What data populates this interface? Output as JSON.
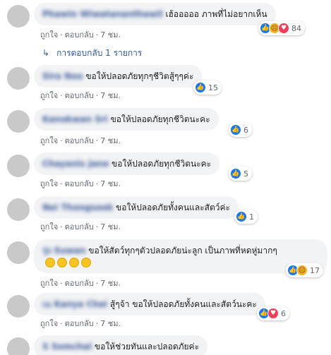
{
  "comments": [
    {
      "name": "Phawin Wiwatananthawil",
      "text": "เฮ้อออออ ภาพที่ไม่อยากเห็น",
      "like": "ถูกใจ",
      "reply": "ตอบกลับ",
      "time": "7 ชม.",
      "reactions": [
        "like",
        "sad",
        "love"
      ],
      "count": "84"
    },
    {
      "name": "Sira Noo",
      "text": "ขอให้ปลอดภัยทุกๆชีวิตสู้ๆๆค่ะ",
      "like": "ถูกใจ",
      "reply": "ตอบกลับ",
      "time": "7 ชม.",
      "reactions": [
        "like"
      ],
      "count": "15"
    },
    {
      "name": "Kanokwan Sri",
      "text": "ขอให้ปลอดภัยทุกชีวิตนะคะ",
      "like": "ถูกใจ",
      "reply": "ตอบกลับ",
      "time": "7 ชม.",
      "reactions": [
        "like"
      ],
      "count": "6"
    },
    {
      "name": "Chayanis Jane",
      "text": "ขอให้ปลอดภัยทุกชีวิตนะคะ",
      "like": "ถูกใจ",
      "reply": "ตอบกลับ",
      "time": "7 ชม.",
      "reactions": [
        "like"
      ],
      "count": "5"
    },
    {
      "name": "Nei Thongsook",
      "text": "ขอให้ปลอดภัยทั้งคนและสัตว์ค่ะ",
      "like": "ถูกใจ",
      "reply": "ตอบกลับ",
      "time": "7 ชม.",
      "reactions": [
        "like"
      ],
      "count": "1"
    },
    {
      "name": "รุ่ง Suwan",
      "text": "ขอให้สัตว์ทุกๆตัวปลอดภัยน่ะลูก เป็นภาพที่หดหู่มากๆ",
      "like": "ถูกใจ",
      "reply": "ตอบกลับ",
      "time": "7 ชม.",
      "reactions": [
        "like",
        "sad"
      ],
      "count": "17"
    },
    {
      "name": "เน Kanya Chai",
      "text": "สู้ๆจ้า ขอให้ปลอดภัยทั้งคนและสัตว์นะคะ",
      "like": "ถูกใจ",
      "reply": "ตอบกลับ",
      "time": "7 ชม.",
      "reactions": [
        "like",
        "love"
      ],
      "count": "6"
    },
    {
      "name": "S Somchai",
      "text": "ขอให้ช่วยทันและปลอดภัยค่ะ"
    }
  ],
  "replies_link": "การตอบกลับ 1 รายการ",
  "separator": "·"
}
